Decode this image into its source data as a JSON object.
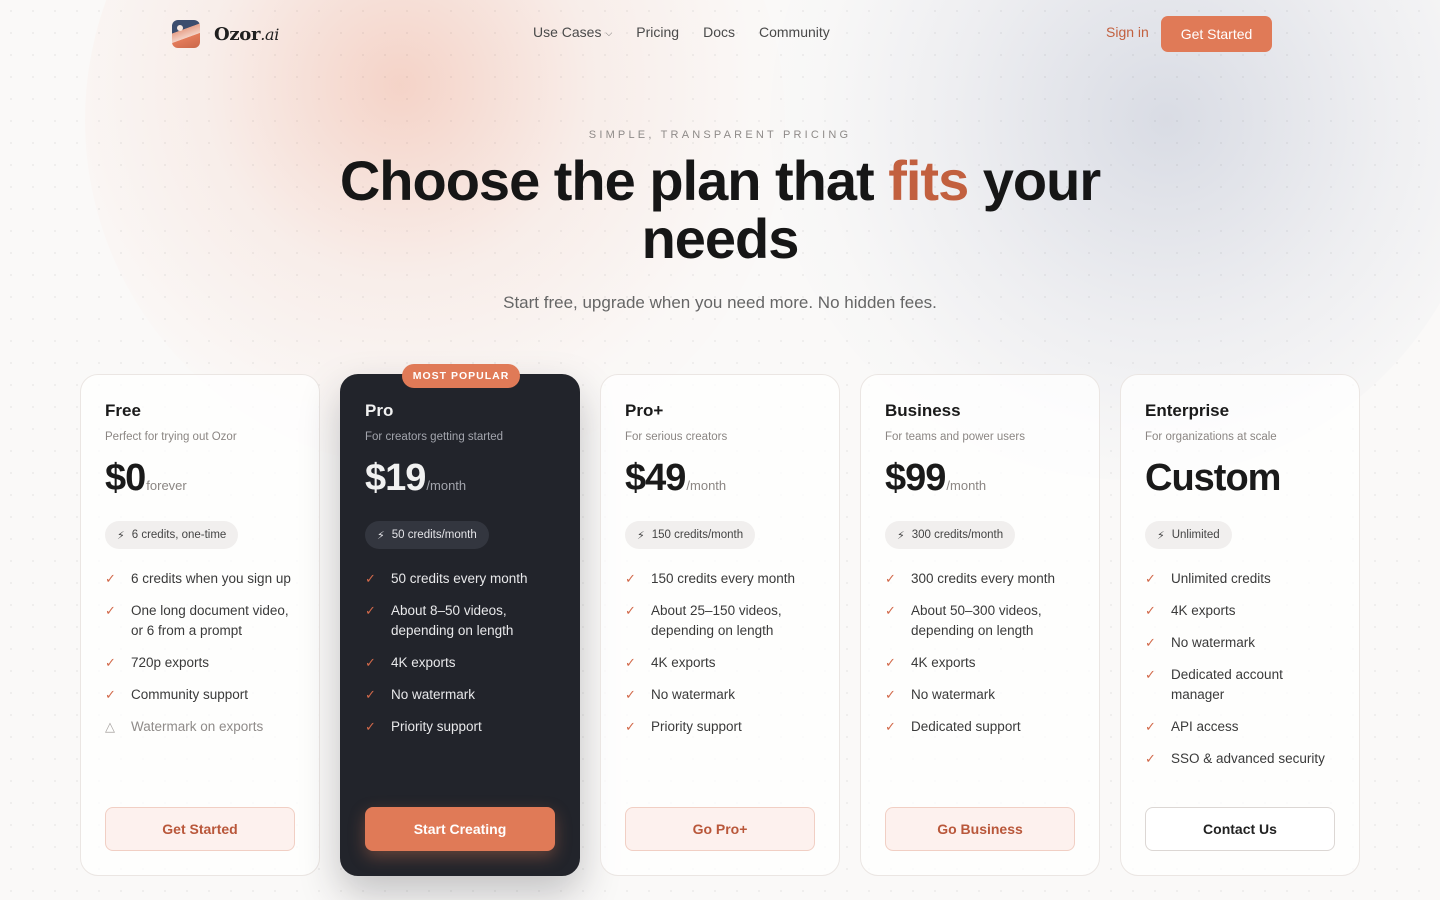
{
  "nav": {
    "brand": "Ozor",
    "brand_suffix": ".ai",
    "links": [
      {
        "label": "Use Cases",
        "has_dropdown": true
      },
      {
        "label": "Pricing"
      },
      {
        "label": "Docs"
      },
      {
        "label": "Community"
      }
    ],
    "sign_in": "Sign in",
    "cta": "Get Started"
  },
  "hero": {
    "eyebrow": "SIMPLE, TRANSPARENT PRICING",
    "headline_before": "Choose the plan that ",
    "headline_accent": "fits",
    "headline_after": " your needs",
    "subtitle": "Start free, upgrade when you need more. No hidden fees."
  },
  "colors": {
    "accent": "#e07a57",
    "accent_text": "#c2603f",
    "dark_card": "#22242b"
  },
  "plans": [
    {
      "name": "Free",
      "desc": "Perfect for trying out Ozor",
      "price": "$0",
      "period": "forever",
      "credits": "6 credits, one-time",
      "features": [
        "6 credits when you sign up",
        "One long document video, or 6 from a prompt",
        "720p exports",
        "Community support"
      ],
      "warning": "Watermark on exports",
      "button": "Get Started"
    },
    {
      "name": "Pro",
      "badge": "MOST POPULAR",
      "desc": "For creators getting started",
      "price": "$19",
      "period": "/month",
      "credits": "50 credits/month",
      "features": [
        "50 credits every month",
        "About 8–50 videos, depending on length",
        "4K exports",
        "No watermark",
        "Priority support"
      ],
      "button": "Start Creating"
    },
    {
      "name": "Pro+",
      "desc": "For serious creators",
      "price": "$49",
      "period": "/month",
      "credits": "150 credits/month",
      "features": [
        "150 credits every month",
        "About 25–150 videos, depending on length",
        "4K exports",
        "No watermark",
        "Priority support"
      ],
      "button": "Go Pro+"
    },
    {
      "name": "Business",
      "desc": "For teams and power users",
      "price": "$99",
      "period": "/month",
      "credits": "300 credits/month",
      "features": [
        "300 credits every month",
        "About 50–300 videos, depending on length",
        "4K exports",
        "No watermark",
        "Dedicated support"
      ],
      "button": "Go Business"
    },
    {
      "name": "Enterprise",
      "desc": "For organizations at scale",
      "price": "Custom",
      "period": "",
      "credits": "Unlimited",
      "features": [
        "Unlimited credits",
        "4K exports",
        "No watermark",
        "Dedicated account manager",
        "API access",
        "SSO & advanced security"
      ],
      "button": "Contact Us"
    }
  ]
}
